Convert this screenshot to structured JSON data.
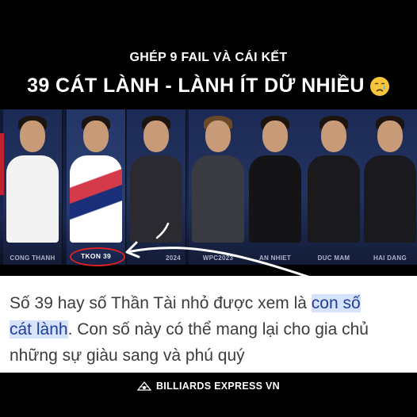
{
  "header": {
    "subtitle": "GHÉP 9 FAIL VÀ CÁI KẾT",
    "title": "39 CÁT LÀNH - LÀNH ÍT DỮ NHIỀU",
    "emoji": "crying-face-icon"
  },
  "players": [
    {
      "label": "CONG THANH"
    },
    {
      "label": "TKON 39",
      "highlighted": true
    },
    {
      "label": "2024"
    },
    {
      "label": "WPC2023"
    },
    {
      "label": "AN NHIET"
    },
    {
      "label": "DUC MAM"
    },
    {
      "label": "HAI DANG"
    }
  ],
  "paragraph": {
    "part1": "Số 39 hay số Thần Tài nhỏ được xem là ",
    "highlight1": "con số",
    "highlight2": "cát lành",
    "part2": ". Con số này có thể mang lại cho gia chủ những sự giàu sang và phú quý"
  },
  "footer": {
    "brand": "BILLIARDS EXPRESS VN",
    "icon": "billiards-logo-icon"
  },
  "colors": {
    "background": "#000000",
    "highlight_bg": "#d6e3fb",
    "highlight_text": "#1f3e9c",
    "circle": "#e02020"
  }
}
